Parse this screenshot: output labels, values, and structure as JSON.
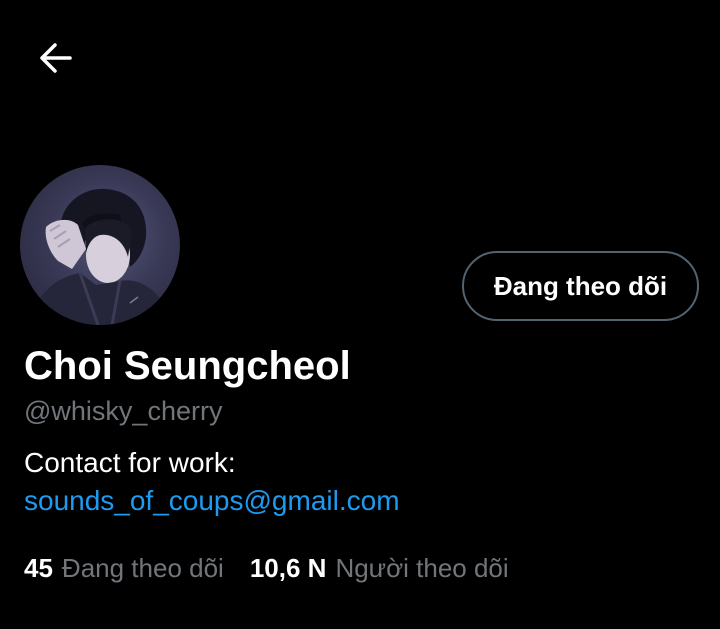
{
  "header": {
    "back_icon": "arrow-left-icon"
  },
  "profile": {
    "avatar_icon": "profile-photo",
    "display_name": "Choi Seungcheol",
    "handle": "@whisky_cherry",
    "bio_line": "Contact for work:",
    "bio_email": "sounds_of_coups@gmail.com",
    "follow_button_label": "Đang theo dõi"
  },
  "stats": {
    "following_count": "45",
    "following_label": "Đang theo dõi",
    "followers_count": "10,6 N",
    "followers_label": "Người theo dõi"
  },
  "colors": {
    "background": "#000000",
    "primary_text": "#ffffff",
    "secondary_text": "#71767b",
    "link": "#1d9bf0",
    "button_border": "#536471"
  }
}
